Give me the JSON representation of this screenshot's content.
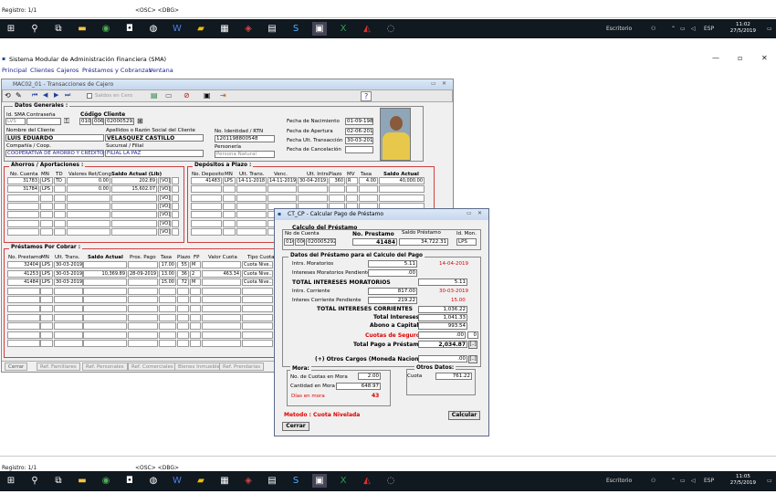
{
  "top_status": {
    "registro": "Registro: 1/1",
    "osc": "<OSC> <DBG>"
  },
  "taskbar": {
    "search_label": "Escritorio",
    "lang": "ESP",
    "time_top": "11:02",
    "date_top": "27/5/2019",
    "time_bottom": "11:05",
    "date_bottom": "27/5/2019"
  },
  "app": {
    "title": "Sistema Modular de Administración Financiera (SMA)"
  },
  "menu": [
    "Principal",
    "Clientes",
    "Cajeros",
    "Préstamos y Cobranzas",
    "Ventana"
  ],
  "main_window": {
    "title": "MAC02_01 - Transacciones de Cajero",
    "saldos_cero": "Saldos en Cero",
    "datos_generales": "Datos Generales :",
    "id_sma_label": "Id. SMA",
    "contrasena_label": "Contraseña",
    "id_sma": "LVS",
    "codigo_cliente_label": "Código Cliente",
    "codigo_a": "010",
    "codigo_b": "006",
    "codigo_c": "020005292",
    "nombre_label": "Nombre del Cliente",
    "nombre": "LUIS EDUARDO",
    "apellidos_label": "Apellidos o Razón Social del Cliente",
    "apellidos": "VELASQUEZ CASTILLO",
    "compania_label": "Compañía / Coop.",
    "compania": "COOPERATIVA DE AHORRO Y CRÉDITO",
    "sucursal_label": "Sucursal / Filial",
    "sucursal": "FILIAL LA PAZ",
    "identidad_label": "No. Identidad / RTN",
    "identidad": "1201198800548",
    "personeria_label": "Personería",
    "personeria": "Persona Natural",
    "fecha_nac_label": "Fecha de Nacimiento",
    "fecha_nac": "01-09-1988",
    "fecha_ap_label": "Fecha de Apertura",
    "fecha_ap": "02-06-2015",
    "fecha_ult_label": "Fecha Ult. Transacción",
    "fecha_ult": "30-03-2019",
    "fecha_canc_label": "Fecha de Cancelación",
    "ahorros_title": "Ahorros / Aportaciones :",
    "ahorros_headers": [
      "No. Cuenta",
      "MN",
      "TD",
      "Valores Ret/Cong",
      "Saldo Actual (Lib)"
    ],
    "ahorros_rows": [
      {
        "cuenta": "31783",
        "mn": "LPS",
        "td": "TD",
        "ret": "0.00",
        "saldo": "202.89",
        "v": "[VO]"
      },
      {
        "cuenta": "31784",
        "mn": "LPS",
        "td": "",
        "ret": "0.00",
        "saldo": "15,602.07",
        "v": "[VO]"
      }
    ],
    "v_empty": "[VO]",
    "depositos_title": "Depósitos a Plazo :",
    "depositos_headers": [
      "No. Deposito",
      "MN",
      "Ult. Trans.",
      "Venc.",
      "Ult. Intrs.",
      "Plazo",
      "MV",
      "Tasa",
      "Saldo Actual"
    ],
    "depositos_rows": [
      {
        "no": "41483",
        "mn": "LPS",
        "ult": "14-11-2018",
        "venc": "14-11-2019",
        "intrs": "30-04-2019",
        "plazo": "360",
        "mv": "R",
        "tasa": "4.00",
        "saldo": "40,000.00"
      }
    ],
    "prestamos_title": "Préstamos Por Cobrar :",
    "prestamos_headers": [
      "No. Prestamo",
      "MN",
      "Ult. Trans.",
      "Saldo Actual",
      "Prox. Pago",
      "Tasa",
      "Plazo",
      "FP",
      "Valor Cuota",
      "Tipo Cuota"
    ],
    "prestamos_rows": [
      {
        "no": "32404",
        "mn": "LPS",
        "ult": "30-03-2019",
        "saldo": "",
        "prox": "",
        "tasa": "17.00",
        "plazo": "55",
        "fp": "M",
        "cuota": "",
        "tipo": "Cuota Nive..."
      },
      {
        "no": "41253",
        "mn": "LPS",
        "ult": "30-03-2019",
        "saldo": "10,369.89",
        "prox": "28-09-2019",
        "tasa": "13.00",
        "plazo": "36",
        "fp": "2",
        "cuota": "463.34",
        "tipo": "Cuota Nive..."
      },
      {
        "no": "41484",
        "mn": "LPS",
        "ult": "30-03-2019",
        "saldo": "",
        "prox": "",
        "tasa": "15.00",
        "plazo": "72",
        "fp": "M",
        "cuota": "",
        "tipo": "Cuota Nive..."
      }
    ],
    "tabs": [
      "Cerrar",
      "Ref. Familiares",
      "Ref. Personales",
      "Ref. Comerciales",
      "Bienes Inmuebles",
      "Ref. Prendarias"
    ]
  },
  "dialog": {
    "title": "CT_CP - Calcular Pago de Préstamo",
    "calculo_title": "Calculo del Préstamo",
    "no_cuenta_label": "No de Cuenta",
    "no_prestamo_label": "No. Prestamo",
    "saldo_prestamo_label": "Saldo Préstamo",
    "id_mon_label": "Id. Mon.",
    "cuenta_a": "010",
    "cuenta_b": "006",
    "cuenta_c": "020005292",
    "no_prestamo": "41484",
    "saldo_prestamo": "34,722.31",
    "id_mon": "LPS",
    "datos_title": "Datos del Préstamo para el Calculo del Pago",
    "intrs_moratorios_label": "Intrs. Moratorios",
    "intrs_moratorios": "5.11",
    "intrs_moratorios_date": "14-04-2019",
    "intrs_mor_pend_label": "Intereses Moratorios Pendientes",
    "intrs_mor_pend": ".00",
    "total_moratorios_label": "TOTAL INTERESES MORATORIOS",
    "total_moratorios": "5.11",
    "intrs_corriente_label": "Intrs. Corriente",
    "intrs_corriente": "817.00",
    "intrs_corriente_date": "30-03-2019",
    "intrs_corr_pend_label": "Interes Corriente Pendiente",
    "intrs_corr_pend": "219.22",
    "intrs_corr_pend_rate": "15.00",
    "total_corrientes_label": "TOTAL INTERESES CORRIENTES",
    "total_corrientes": "1,036.22",
    "total_intereses_label": "Total Intereses",
    "total_intereses": "1,041.33",
    "abono_label": "Abono a Capital",
    "abono": "993.54",
    "seguro_label": "Cuotas de Seguro",
    "seguro": ".00",
    "seguro_count": "0",
    "total_pago_label": "Total Pago a Préstamo",
    "total_pago": "2,034.87",
    "otros_cargos_label": "(+) Otros Cargos (Moneda Nacional)",
    "otros_cargos": ".00",
    "mora_title": "Mora:",
    "no_cuotas_mora_label": "No. de Cuotas en Mora",
    "no_cuotas_mora": "2.00",
    "cantidad_mora_label": "Cantidad en Mora",
    "cantidad_mora": "648.97",
    "dias_mora_label": "Días en mora",
    "dias_mora": "43",
    "otros_title": "Otros Datos:",
    "cuota_label": "Cuota",
    "cuota": "761.22",
    "metodo_label": "Metodo : Cuota Nivelada",
    "calcular": "Calcular",
    "cerrar": "Cerrar"
  }
}
